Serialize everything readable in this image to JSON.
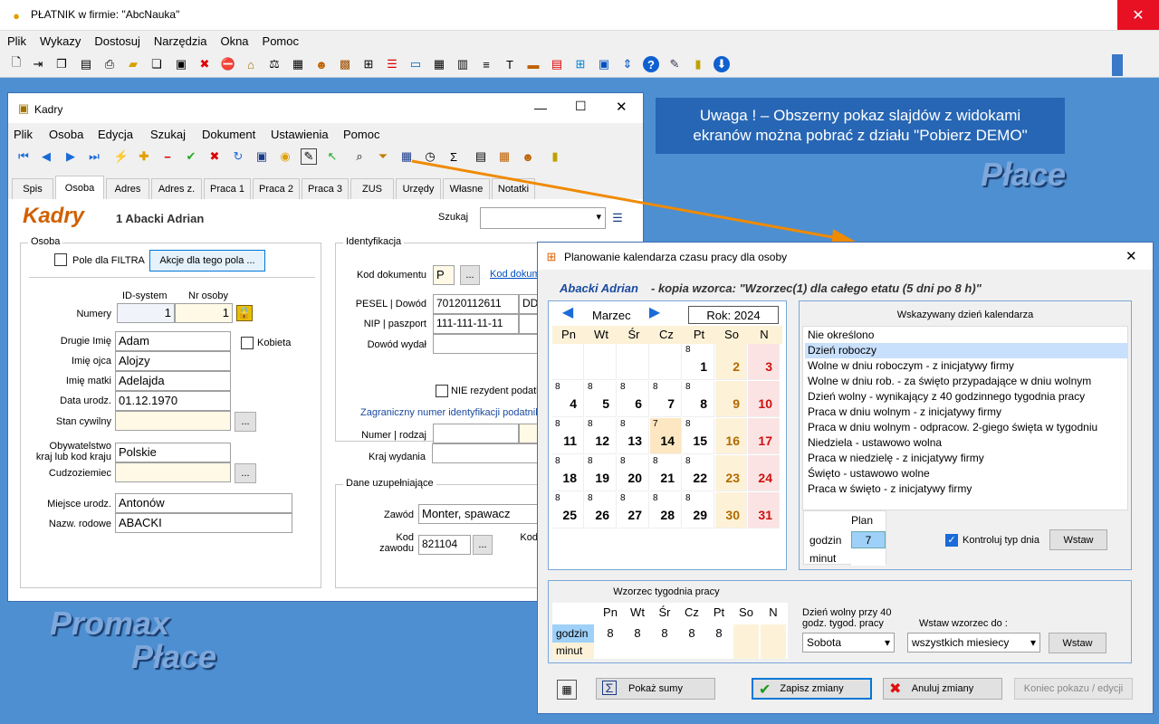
{
  "app": {
    "title": "PŁATNIK  w firmie:  \"AbcNauka\"",
    "menu": [
      "Plik",
      "Wykazy",
      "Dostosuj",
      "Narzędzia",
      "Okna",
      "Pomoc"
    ],
    "close": "✕"
  },
  "kadry": {
    "title": "Kadry",
    "menu": [
      "Plik",
      "Osoba",
      "Edycja",
      "Szukaj",
      "Dokument",
      "Ustawienia",
      "Pomoc"
    ],
    "tabs": [
      "Spis",
      "Osoba",
      "Adres",
      "Adres z.",
      "Praca 1",
      "Praca 2",
      "Praca 3",
      "ZUS",
      "Urzędy",
      "Własne",
      "Notatki"
    ],
    "heading": "Kadry",
    "person": "1  Abacki Adrian",
    "search_label": "Szukaj",
    "osoba": {
      "group": "Osoba",
      "filtr": "Pole dla FILTRA",
      "akcje": "Akcje dla tego pola ...",
      "id_system": "ID-system",
      "nr_osoby": "Nr osoby",
      "numery": "Numery",
      "id_val": "1",
      "nr_val": "1",
      "fields": [
        {
          "label": "Drugie Imię",
          "value": "Adam"
        },
        {
          "label": "Imię ojca",
          "value": "Alojzy"
        },
        {
          "label": "Imię matki",
          "value": "Adelajda"
        },
        {
          "label": "Data urodz.",
          "value": "01.12.1970"
        },
        {
          "label": "Stan cywilny",
          "value": ""
        }
      ],
      "kobieta": "Kobieta",
      "obyw_label": "Obywatelstwo\nkraj lub kod kraju",
      "obyw": "Polskie",
      "cudz": "Cudzoziemiec",
      "miejsce_label": "Miejsce urodz.",
      "miejsce": "Antonów",
      "nazw_label": "Nazw. rodowe",
      "nazw": "ABACKI"
    },
    "ident": {
      "group": "Identyfikacja",
      "kod_dok": "Kod dokumentu",
      "kod_val": "P",
      "kod_link": "Kod  dokum",
      "pesel": "PESEL | Dowód",
      "pesel_val": "70120112611",
      "dd": "DD",
      "nip": "NIP | paszport",
      "nip_val": "111-111-11-11",
      "dowod": "Dowód wydał",
      "nie_rez": "NIE rezydent podatk",
      "zagr": "Zagraniczny numer identyfikacji podatnik",
      "numer": "Numer | rodzaj",
      "kraj": "Kraj wydania"
    },
    "dane": {
      "group": "Dane uzupełniające",
      "zawod": "Zawód",
      "zawod_val": "Monter, spawacz",
      "kod_zawodu": "Kod\nzawodu",
      "kod_zawodu_val": "821104",
      "kod_w": "Kod w\ntał"
    }
  },
  "banner": {
    "line1": "Uwaga ! – Obszerny pokaz slajdów z widokami",
    "line2": "ekranów można pobrać z działu \"Pobierz DEMO\""
  },
  "brand": {
    "place_top": "Płace",
    "promax": "Promax",
    "place_bottom": "Płace"
  },
  "plan": {
    "title": "Planowanie kalendarza czasu pracy dla osoby",
    "person": "Abacki Adrian",
    "desc": "- kopia wzorca:  \"Wzorzec(1) dla całego etatu (5 dni po 8 h)\"",
    "month": "Marzec",
    "year": "Rok:  2024",
    "days": [
      "Pn",
      "Wt",
      "Śr",
      "Cz",
      "Pt",
      "So",
      "N"
    ],
    "weeks": [
      [
        [
          "",
          ""
        ],
        [
          "",
          ""
        ],
        [
          "",
          ""
        ],
        [
          "",
          ""
        ],
        [
          "1",
          "8"
        ],
        [
          "2",
          ""
        ],
        [
          "3",
          ""
        ]
      ],
      [
        [
          "4",
          "8"
        ],
        [
          "5",
          "8"
        ],
        [
          "6",
          "8"
        ],
        [
          "7",
          "8"
        ],
        [
          "8",
          "8"
        ],
        [
          "9",
          ""
        ],
        [
          "10",
          ""
        ]
      ],
      [
        [
          "11",
          "8"
        ],
        [
          "12",
          "8"
        ],
        [
          "13",
          "8"
        ],
        [
          "14",
          "7"
        ],
        [
          "15",
          "8"
        ],
        [
          "16",
          ""
        ],
        [
          "17",
          ""
        ]
      ],
      [
        [
          "18",
          "8"
        ],
        [
          "19",
          "8"
        ],
        [
          "20",
          "8"
        ],
        [
          "21",
          "8"
        ],
        [
          "22",
          "8"
        ],
        [
          "23",
          ""
        ],
        [
          "24",
          ""
        ]
      ],
      [
        [
          "25",
          "8"
        ],
        [
          "26",
          "8"
        ],
        [
          "27",
          "8"
        ],
        [
          "28",
          "8"
        ],
        [
          "29",
          "8"
        ],
        [
          "30",
          ""
        ],
        [
          "31",
          ""
        ]
      ]
    ],
    "list_title": "Wskazywany dzień kalendarza",
    "list": [
      "Nie określono",
      "Dzień roboczy",
      "Wolne w dniu roboczym - z inicjatywy firmy",
      "Wolne w dniu rob. - za święto przypadające w dniu wolnym",
      "Dzień wolny - wynikający z 40 godzinnego tygodnia pracy",
      "Praca w dniu wolnym - z inicjatywy firmy",
      "Praca w dniu wolnym - odpracow. 2-giego święta w tygodniu",
      "Niedziela - ustawowo wolna",
      "Praca w niedzielę - z inicjatywy firmy",
      "Święto - ustawowo wolne",
      "Praca w święto - z inicjatywy firmy"
    ],
    "plan_hdr": "Plan",
    "godzin": "godzin",
    "minut": "minut",
    "plan_val": "7",
    "kontroluj": "Kontroluj typ dnia",
    "wstaw": "Wstaw",
    "wzorzec_title": "Wzorzec tygodnia pracy",
    "wz_days": [
      "Pn",
      "Wt",
      "Śr",
      "Cz",
      "Pt",
      "So",
      "N"
    ],
    "wz_godz": [
      "8",
      "8",
      "8",
      "8",
      "8",
      "",
      ""
    ],
    "dzien_wolny": "Dzień wolny przy 40\ngodz. tygod. pracy",
    "sobota": "Sobota",
    "wstaw_wzorzec": "Wstaw wzorzec  do :",
    "wszystkich": "wszystkich miesiecy",
    "wstaw2": "Wstaw",
    "pokaz_sumy": "Pokaż sumy",
    "zapisz": "Zapisz zmiany",
    "anuluj": "Anuluj zmiany",
    "koniec": "Koniec pokazu / edycji"
  }
}
